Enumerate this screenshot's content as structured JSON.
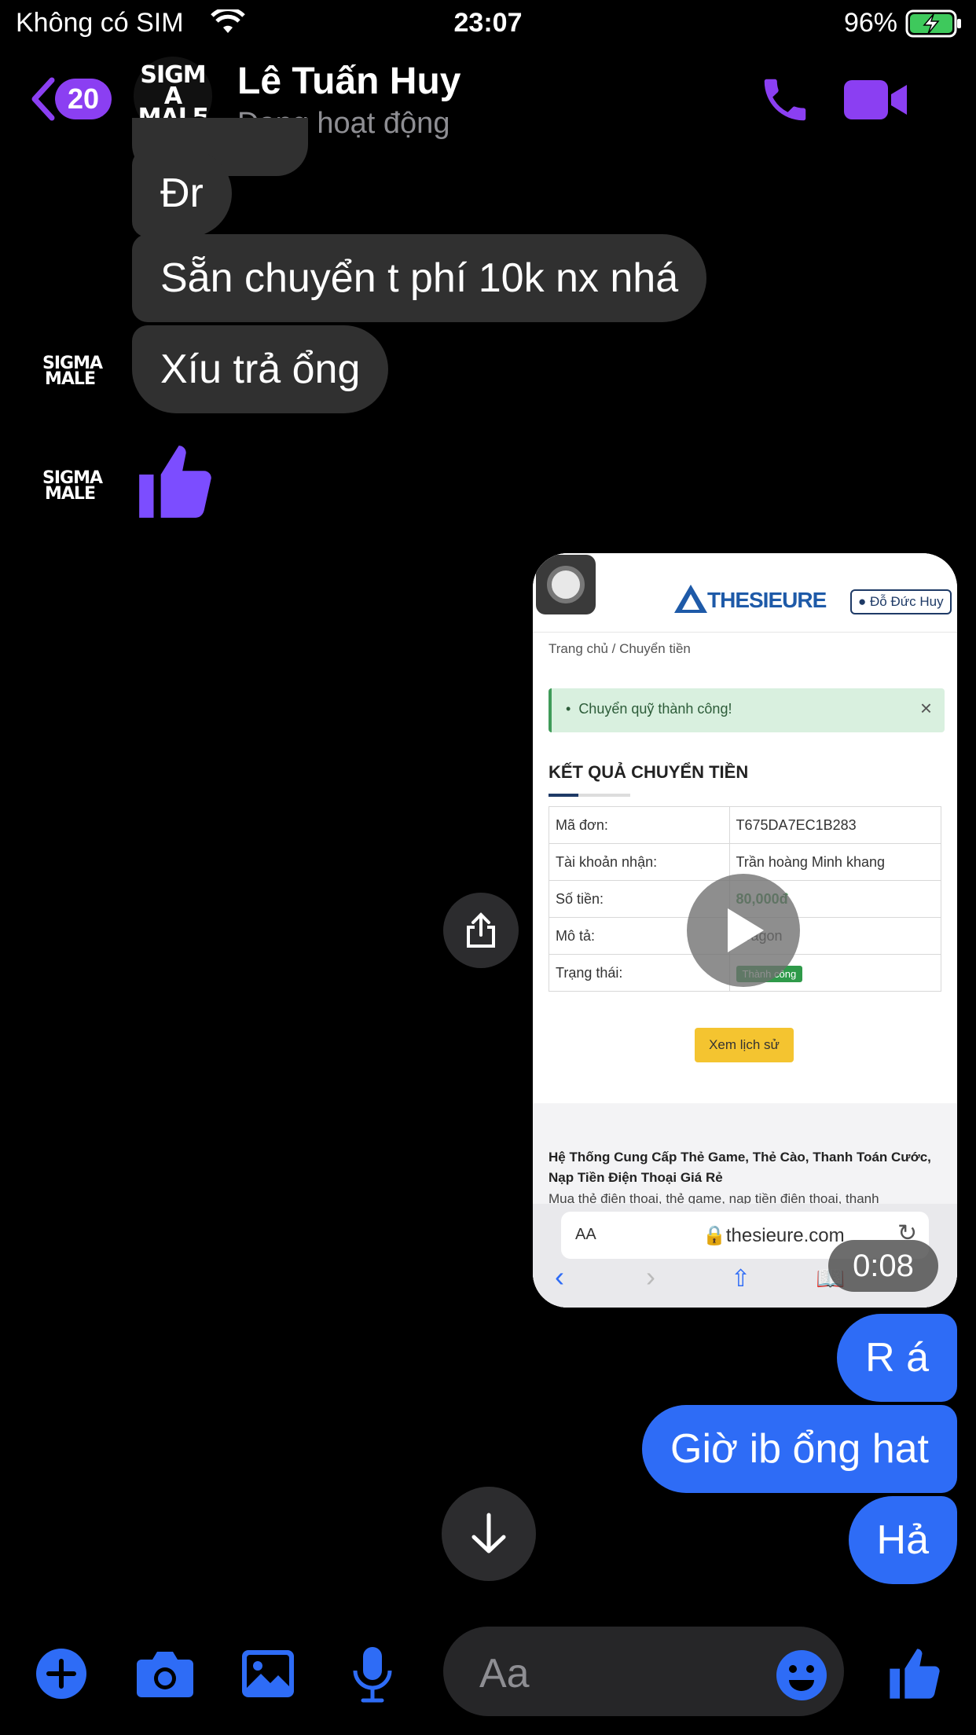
{
  "status_bar": {
    "carrier": "Không có SIM",
    "time": "23:07",
    "battery": "96%"
  },
  "header": {
    "back_count": "20",
    "name": "Lê Tuấn Huy",
    "status": "Đang hoạt động",
    "avatar_text": "SIGMA MALE"
  },
  "messages": {
    "in_1": "Đr",
    "in_2": "Sẵn chuyển t phí 10k nx nhá",
    "in_3": "Xíu trả ổng",
    "out_1": "R á",
    "out_2": "Giờ ib ổng hat",
    "out_3": "Hả"
  },
  "video": {
    "duration": "0:08",
    "screenshot": {
      "brand": "THESIEURE",
      "user": "Đỗ Đức Huy",
      "breadcrumb_home": "Trang chủ",
      "breadcrumb_sep": "/",
      "breadcrumb_current": "Chuyển tiền",
      "alert": "Chuyển quỹ thành công!",
      "alert_close": "×",
      "section_title": "KẾT QUẢ CHUYỂN TIỀN",
      "rows": [
        {
          "label": "Mã đơn:",
          "value": "T675DA7EC1B283"
        },
        {
          "label": "Tài khoản nhận:",
          "value": "Trần hoàng Minh khang"
        },
        {
          "label": "Số tiền:",
          "value": "80,000đ"
        },
        {
          "label": "Mô tả:",
          "value": "Dragon"
        },
        {
          "label": "Trạng thái:",
          "value": "Thành công"
        }
      ],
      "history_button": "Xem lịch sử",
      "footer_heading": "Hệ Thống Cung Cấp Thẻ Game, Thẻ Cào, Thanh Toán Cước, Nạp Tiền Điện Thoại Giá Rẻ",
      "footer_text": "Mua thẻ điện thoại, thẻ game, nạp tiền điện thoại, thanh",
      "url_aa": "AA",
      "url": "thesieure.com"
    }
  },
  "composer": {
    "placeholder": "Aa"
  },
  "colors": {
    "accent_purple": "#8b3ff2",
    "outgoing_blue": "#2e6cf6",
    "incoming_gray": "#303030",
    "online_green": "#3ec95c"
  }
}
